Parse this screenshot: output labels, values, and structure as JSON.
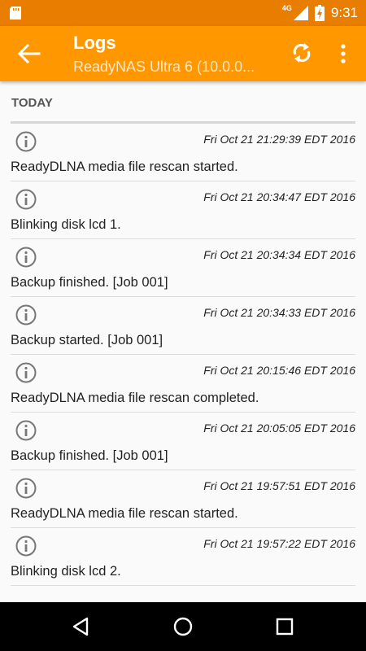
{
  "status_bar": {
    "time": "9:31",
    "network": "4G"
  },
  "app_bar": {
    "title": "Logs",
    "subtitle": "ReadyNAS Ultra 6 (10.0.0..."
  },
  "section": {
    "header": "TODAY"
  },
  "logs": [
    {
      "timestamp": "Fri Oct 21 21:29:39 EDT 2016",
      "message": "ReadyDLNA media file rescan started."
    },
    {
      "timestamp": "Fri Oct 21 20:34:47 EDT 2016",
      "message": "Blinking disk lcd 1."
    },
    {
      "timestamp": "Fri Oct 21 20:34:34 EDT 2016",
      "message": "Backup finished. [Job 001]"
    },
    {
      "timestamp": "Fri Oct 21 20:34:33 EDT 2016",
      "message": "Backup started. [Job 001]"
    },
    {
      "timestamp": "Fri Oct 21 20:15:46 EDT 2016",
      "message": "ReadyDLNA media file rescan completed."
    },
    {
      "timestamp": "Fri Oct 21 20:05:05 EDT 2016",
      "message": "Backup finished. [Job 001]"
    },
    {
      "timestamp": "Fri Oct 21 19:57:51 EDT 2016",
      "message": "ReadyDLNA media file rescan started."
    },
    {
      "timestamp": "Fri Oct 21 19:57:22 EDT 2016",
      "message": "Blinking disk lcd 2."
    }
  ],
  "colors": {
    "status_bar": "#e87d00",
    "app_bar": "#ff9800",
    "accent_text": "#ffffff"
  }
}
